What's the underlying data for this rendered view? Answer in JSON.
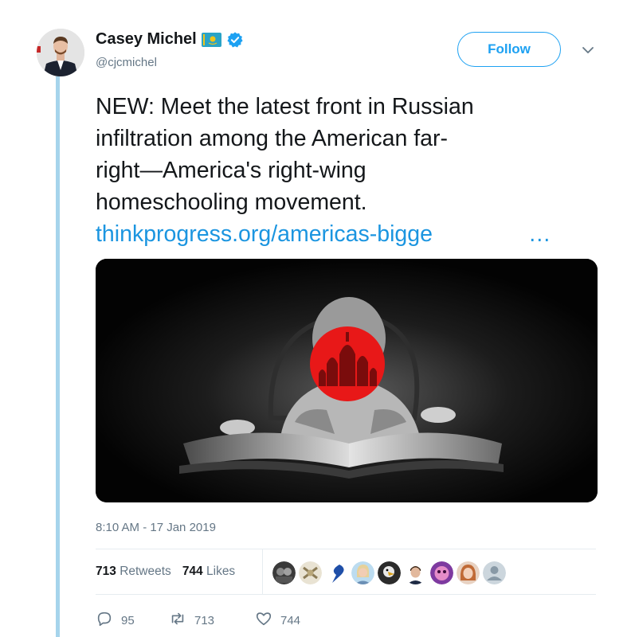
{
  "user": {
    "display_name": "Casey Michel",
    "handle": "@cjcmichel",
    "flag_icon": "kazakhstan-flag-icon",
    "verified_icon": "verified-badge-icon"
  },
  "follow_label": "Follow",
  "tweet": {
    "text_lines": [
      "NEW: Meet the latest front in Russian",
      "infiltration among the American far-",
      "right—America's right-wing",
      "homeschooling movement."
    ],
    "link_text": "thinkprogress.org/americas-bigge",
    "link_ellipsis": "…"
  },
  "timestamp": "8:10 AM - 17 Jan 2019",
  "stats": {
    "retweets_count": "713",
    "retweets_label": "Retweets",
    "likes_count": "744",
    "likes_label": "Likes"
  },
  "actions": {
    "replies": "95",
    "retweets": "713",
    "likes": "744"
  },
  "colors": {
    "accent": "#1da1f2",
    "link": "#1b95e0",
    "thread_line": "#a6d4ec",
    "secondary_text": "#657786"
  }
}
